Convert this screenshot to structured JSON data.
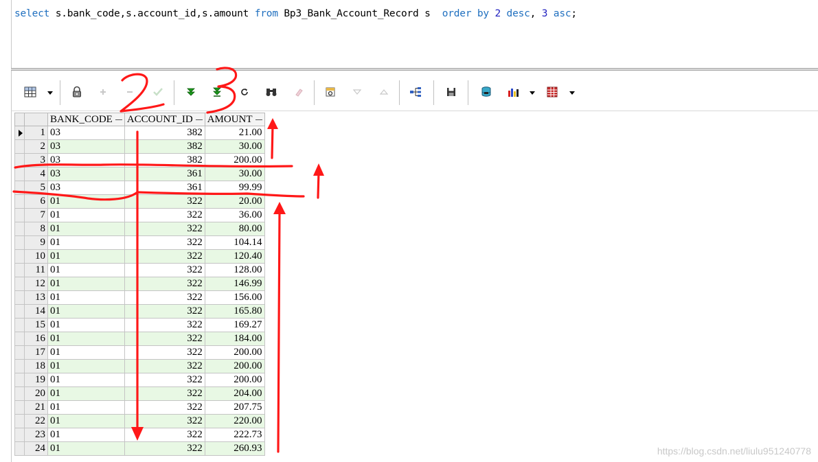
{
  "editor": {
    "sql": {
      "p1": "select",
      "p2": " s.bank_code,s.account_id,s.amount ",
      "p3": "from",
      "p4": " Bp3_Bank_Account_Record s  ",
      "p5": "order by",
      "p6": " ",
      "p7": "2",
      "p8": " ",
      "p9": "desc",
      "p10": ", ",
      "p11": "3",
      "p12": " ",
      "p13": "asc",
      "p14": ";"
    }
  },
  "toolbar": {
    "icons": [
      "grid-icon",
      "lock-icon",
      "plus-icon",
      "minus-icon",
      "check-icon",
      "fetch-next-icon",
      "fetch-last-icon",
      "refresh-icon",
      "find-icon",
      "clear-icon",
      "query-by-example-icon",
      "sort-down-icon",
      "sort-up-icon",
      "tree-icon",
      "save-icon",
      "database-icon",
      "chart-icon",
      "table-icon"
    ]
  },
  "grid": {
    "columns": [
      "BANK_CODE",
      "ACCOUNT_ID",
      "AMOUNT"
    ],
    "rows": [
      {
        "n": "1",
        "bank_code": "03",
        "account_id": "382",
        "amount": "21.00"
      },
      {
        "n": "2",
        "bank_code": "03",
        "account_id": "382",
        "amount": "30.00"
      },
      {
        "n": "3",
        "bank_code": "03",
        "account_id": "382",
        "amount": "200.00"
      },
      {
        "n": "4",
        "bank_code": "03",
        "account_id": "361",
        "amount": "30.00"
      },
      {
        "n": "5",
        "bank_code": "03",
        "account_id": "361",
        "amount": "99.99"
      },
      {
        "n": "6",
        "bank_code": "01",
        "account_id": "322",
        "amount": "20.00"
      },
      {
        "n": "7",
        "bank_code": "01",
        "account_id": "322",
        "amount": "36.00"
      },
      {
        "n": "8",
        "bank_code": "01",
        "account_id": "322",
        "amount": "80.00"
      },
      {
        "n": "9",
        "bank_code": "01",
        "account_id": "322",
        "amount": "104.14"
      },
      {
        "n": "10",
        "bank_code": "01",
        "account_id": "322",
        "amount": "120.40"
      },
      {
        "n": "11",
        "bank_code": "01",
        "account_id": "322",
        "amount": "128.00"
      },
      {
        "n": "12",
        "bank_code": "01",
        "account_id": "322",
        "amount": "146.99"
      },
      {
        "n": "13",
        "bank_code": "01",
        "account_id": "322",
        "amount": "156.00"
      },
      {
        "n": "14",
        "bank_code": "01",
        "account_id": "322",
        "amount": "165.80"
      },
      {
        "n": "15",
        "bank_code": "01",
        "account_id": "322",
        "amount": "169.27"
      },
      {
        "n": "16",
        "bank_code": "01",
        "account_id": "322",
        "amount": "184.00"
      },
      {
        "n": "17",
        "bank_code": "01",
        "account_id": "322",
        "amount": "200.00"
      },
      {
        "n": "18",
        "bank_code": "01",
        "account_id": "322",
        "amount": "200.00"
      },
      {
        "n": "19",
        "bank_code": "01",
        "account_id": "322",
        "amount": "200.00"
      },
      {
        "n": "20",
        "bank_code": "01",
        "account_id": "322",
        "amount": "204.00"
      },
      {
        "n": "21",
        "bank_code": "01",
        "account_id": "322",
        "amount": "207.75"
      },
      {
        "n": "22",
        "bank_code": "01",
        "account_id": "322",
        "amount": "220.00"
      },
      {
        "n": "23",
        "bank_code": "01",
        "account_id": "322",
        "amount": "222.73"
      },
      {
        "n": "24",
        "bank_code": "01",
        "account_id": "322",
        "amount": "260.93"
      }
    ]
  },
  "annotations": {
    "label_2": "2",
    "label_3": "3",
    "color": "#ff2020"
  },
  "watermark": "https://blog.csdn.net/liulu951240778"
}
